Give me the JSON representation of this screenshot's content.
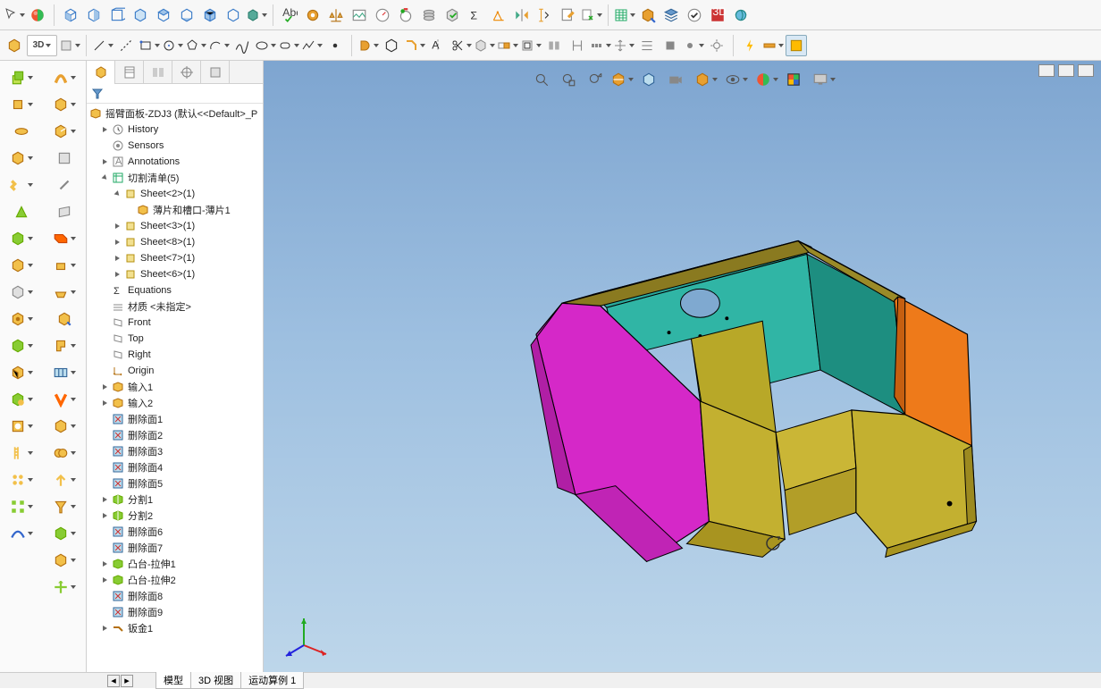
{
  "top_toolbar": {
    "groups": [
      [
        "cursor-select",
        "appearance-ball"
      ],
      [
        "view-front",
        "view-back",
        "view-left",
        "view-right",
        "view-top",
        "view-bottom",
        "view-iso",
        "box-outline",
        "view-cube-mode"
      ],
      [
        "spell-check",
        "link",
        "balance",
        "image",
        "gauge",
        "timer",
        "stack",
        "cube-check",
        "sigma",
        "geometry",
        "mirror",
        "dimension-y",
        "sheet-edit",
        "sheet-x"
      ],
      [
        "table",
        "export",
        "layers",
        "check-circle",
        "brand",
        "globe-sync"
      ]
    ]
  },
  "toolbar2": {
    "items": [
      "edge-cube",
      "3d-mode",
      "dropdown-cube",
      "line",
      "centerline",
      "corner-rect",
      "center-rect",
      "circle",
      "arc",
      "spline",
      "ellipse",
      "fillet",
      "polyline",
      "point",
      "text",
      "plane-grid",
      "ref-line",
      "ref-line2"
    ],
    "right": [
      "revolve",
      "hex",
      "visibility",
      "v-line",
      "text-a",
      "trim",
      "box-ref",
      "offset",
      "wall",
      "align",
      "pattern-l",
      "pattern-g",
      "array",
      "menu",
      "stop",
      "dot",
      "settings",
      "bolt",
      "measure",
      "layers-panel"
    ]
  },
  "left_col_a": [
    "extrude",
    "revolve",
    "revolve2",
    "hex",
    "zigzag",
    "wedge",
    "revolve-cut",
    "cube",
    "hem",
    "cube-dot",
    "sweep",
    "cube-face",
    "loft",
    "hole",
    "zip",
    "cluster",
    "pattern-hv",
    "curve"
  ],
  "left_col_b": [
    "curve-edit",
    "cube-gold",
    "cube-gold2",
    "face",
    "cube-white",
    "slash",
    "grid",
    "orange-box",
    "gold-small",
    "gold-mid",
    "extract",
    "bracket",
    "grid-blue",
    "orange-v",
    "revolve-g",
    "boolean",
    "up-arrow",
    "funnel",
    "green-cube",
    "cube-g2",
    "move"
  ],
  "panel_tabs": [
    "feature-tree",
    "config",
    "display-pane",
    "crosshair",
    "spreadsheet",
    "play"
  ],
  "tree": {
    "root": "摇臂面板-ZDJ3  (默认<<Default>_P",
    "history": "History",
    "sensors": "Sensors",
    "annotations": "Annotations",
    "cutlist": "切割清单(5)",
    "sheets": [
      "Sheet<2>(1)",
      "Sheet<3>(1)",
      "Sheet<8>(1)",
      "Sheet<7>(1)",
      "Sheet<6>(1)"
    ],
    "sheet2_child": "薄片和槽口-薄片1",
    "equations": "Equations",
    "material": "材质 <未指定>",
    "planes": [
      "Front",
      "Top",
      "Right"
    ],
    "origin": "Origin",
    "features": [
      "输入1",
      "输入2",
      "删除面1",
      "删除面2",
      "删除面3",
      "删除面4",
      "删除面5",
      "分割1",
      "分割2",
      "删除面6",
      "删除面7",
      "凸台-拉伸1",
      "凸台-拉伸2",
      "删除面8",
      "删除面9",
      "钣金1"
    ]
  },
  "view_toolbar": [
    "zoom-fit",
    "zoom-area",
    "zoom-prev",
    "section",
    "perspective",
    "shaded",
    "camera",
    "sep",
    "display-style",
    "sep",
    "eye",
    "sep",
    "color-mode",
    "appearance",
    "sep",
    "monitor"
  ],
  "bottom_tabs": [
    "模型",
    "3D 视图",
    "运动算例 1"
  ]
}
